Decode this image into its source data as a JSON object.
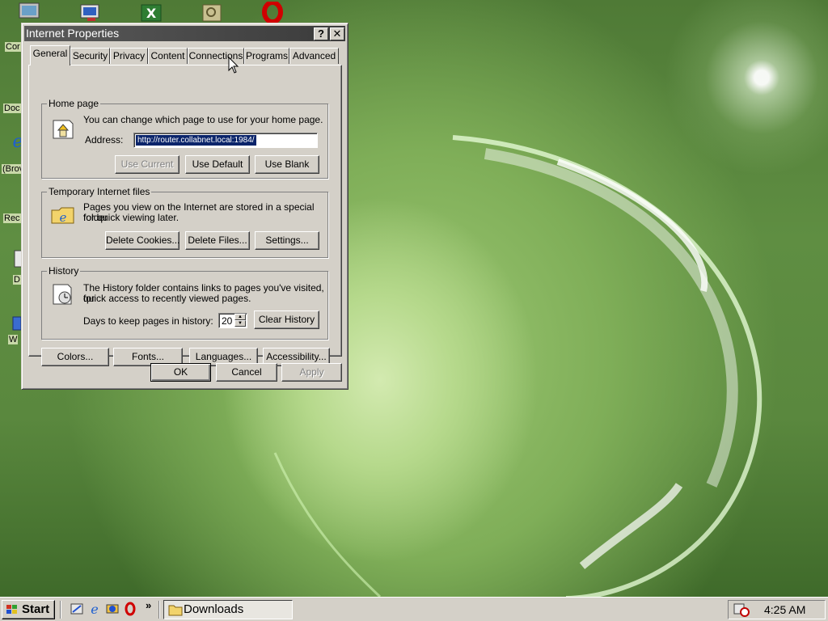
{
  "dialog": {
    "title": "Internet Properties",
    "help_glyph": "?",
    "close_glyph": "✕",
    "tabs": [
      "General",
      "Security",
      "Privacy",
      "Content",
      "Connections",
      "Programs",
      "Advanced"
    ],
    "active_tab": "General",
    "home_page": {
      "group_label": "Home page",
      "description": "You can change which page to use for your home page.",
      "address_label": "Address:",
      "address_value": "http://router.collabnet.local:1984/",
      "buttons": [
        "Use Current",
        "Use Default",
        "Use Blank"
      ]
    },
    "temp_files": {
      "group_label": "Temporary Internet files",
      "description_line1": "Pages you view on the Internet are stored in a special folder",
      "description_line2": "for quick viewing later.",
      "buttons": [
        "Delete Cookies...",
        "Delete Files...",
        "Settings..."
      ]
    },
    "history": {
      "group_label": "History",
      "description_line1": "The History folder contains links to pages you've visited, for",
      "description_line2": "quick access to recently viewed pages.",
      "days_label": "Days to keep pages in history:",
      "days_value": "20",
      "clear_button": "Clear History"
    },
    "bottom_buttons": [
      "Colors...",
      "Fonts...",
      "Languages...",
      "Accessibility..."
    ],
    "footer_buttons": [
      "OK",
      "Cancel",
      "Apply"
    ]
  },
  "desktop": {
    "icon_labels": [
      "Cor",
      "Doc",
      "(Brov",
      "Rec",
      "D",
      "W"
    ]
  },
  "taskbar": {
    "start_label": "Start",
    "chevron": "»",
    "task_label": "Downloads",
    "clock": "4:25 AM"
  },
  "colors": {
    "dialog_face": "#d4d0c8",
    "titlebar": "#3b3b3b",
    "selection": "#0a246a",
    "desktop_green": "#7fae58"
  }
}
